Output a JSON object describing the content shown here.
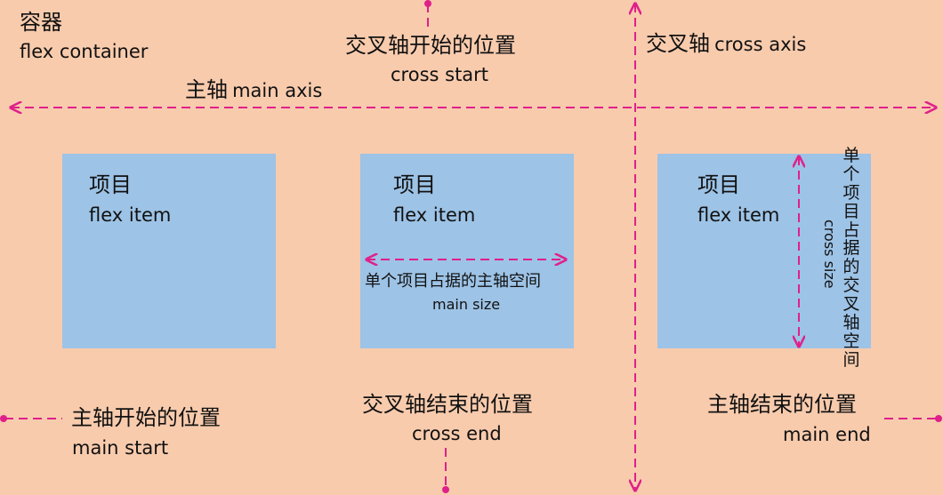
{
  "colors": {
    "background": "#f8cbad",
    "item": "#9dc3e6",
    "accent": "#e0208a"
  },
  "container": {
    "zh": "容器",
    "en": "flex container"
  },
  "main_axis": {
    "zh": "主轴",
    "en": "main axis"
  },
  "cross_axis": {
    "zh": "交叉轴",
    "en": "cross axis"
  },
  "cross_start": {
    "zh": "交叉轴开始的位置",
    "en": "cross start"
  },
  "cross_end": {
    "zh": "交叉轴结束的位置",
    "en": "cross end"
  },
  "main_start": {
    "zh": "主轴开始的位置",
    "en": "main start"
  },
  "main_end": {
    "zh": "主轴结束的位置",
    "en": "main end"
  },
  "items": [
    {
      "zh": "项目",
      "en": "flex item"
    },
    {
      "zh": "项目",
      "en": "flex item"
    },
    {
      "zh": "项目",
      "en": "flex item"
    }
  ],
  "main_size": {
    "zh": "单个项目占据的主轴空间",
    "en": "main size"
  },
  "cross_size": {
    "zh": "单个项目占据的交叉轴空间",
    "en": "cross size"
  }
}
